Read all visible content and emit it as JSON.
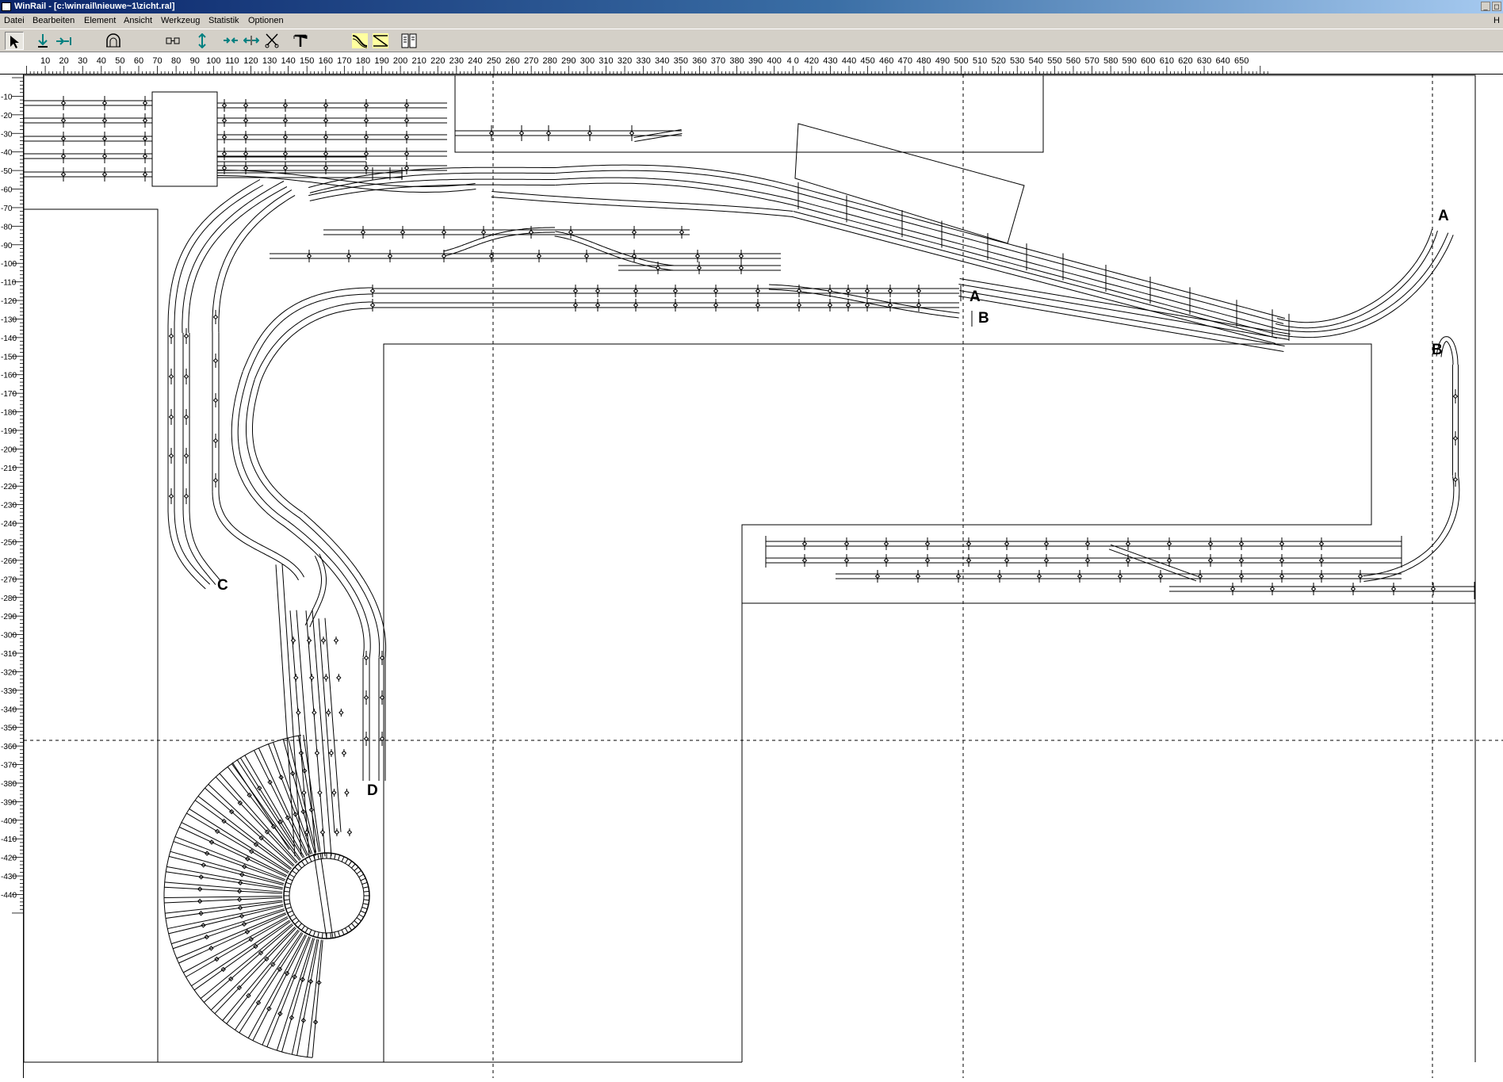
{
  "window": {
    "title": "WinRail - [c:\\winrail\\nieuwe~1\\zicht.ral]"
  },
  "menu": {
    "items": [
      {
        "label": "Datei"
      },
      {
        "label": "Bearbeiten"
      },
      {
        "label": "Element"
      },
      {
        "label": "Ansicht"
      },
      {
        "label": "Werkzeug"
      },
      {
        "label": "Statistik"
      },
      {
        "label": "Optionen"
      }
    ],
    "right": "H"
  },
  "toolbar": {
    "tools": [
      {
        "icon": "select-arrow-icon",
        "active": true
      },
      {
        "icon": "insert-down-icon"
      },
      {
        "icon": "connect-icon"
      },
      {
        "icon": "tunnel-icon"
      },
      {
        "icon": "measure-icon"
      },
      {
        "icon": "vertical-move-icon"
      },
      {
        "icon": "join-icon"
      },
      {
        "icon": "split-icon"
      },
      {
        "icon": "cut-icon"
      },
      {
        "icon": "text-icon"
      },
      {
        "icon": "flex-track-icon"
      },
      {
        "icon": "turnout-icon"
      },
      {
        "icon": "library-icon"
      }
    ]
  },
  "rulers": {
    "horizontal_labels": [
      "10",
      "20",
      "30",
      "40",
      "50",
      "60",
      "70",
      "80",
      "90",
      "100",
      "110",
      "120",
      "130",
      "140",
      "150",
      "160",
      "170",
      "180",
      "190",
      "200",
      "210",
      "220",
      "230",
      "240",
      "250",
      "260",
      "270",
      "280",
      "290",
      "300",
      "310",
      "320",
      "330",
      "340",
      "350",
      "360",
      "370",
      "380",
      "390",
      "400",
      "4 0",
      "420",
      "430",
      "440",
      "450",
      "460",
      "470",
      "480",
      "490",
      "500",
      "510",
      "520",
      "530",
      "540",
      "550",
      "560",
      "570",
      "580",
      "590",
      "600",
      "610",
      "620",
      "630",
      "640",
      "650"
    ],
    "vertical_labels": [
      "-10",
      "-20",
      "-30",
      "-40",
      "-50",
      "-60",
      "-70",
      "-80",
      "-90",
      "-100",
      "-110",
      "-120",
      "-130",
      "-140",
      "-150",
      "-160",
      "-170",
      "-180",
      "-190",
      "-200",
      "-210",
      "-220",
      "-230",
      "-240",
      "-250",
      "-260",
      "-270",
      "-280",
      "-290",
      "-300",
      "-310",
      "-320",
      "-330",
      "-340",
      "-350",
      "-360",
      "-370",
      "-380",
      "-390",
      "-400",
      "-410",
      "-420",
      "-430",
      "-440"
    ]
  },
  "layout_labels": {
    "a_right": "A",
    "a_mid": "A",
    "b_mid": "B",
    "b_right": "B",
    "c": "C",
    "d": "D"
  },
  "colors": {
    "titlebar_start": "#0a246a",
    "titlebar_end": "#a6caf0",
    "chrome": "#d4d0c8",
    "track": "#000000",
    "canvas": "#ffffff"
  }
}
